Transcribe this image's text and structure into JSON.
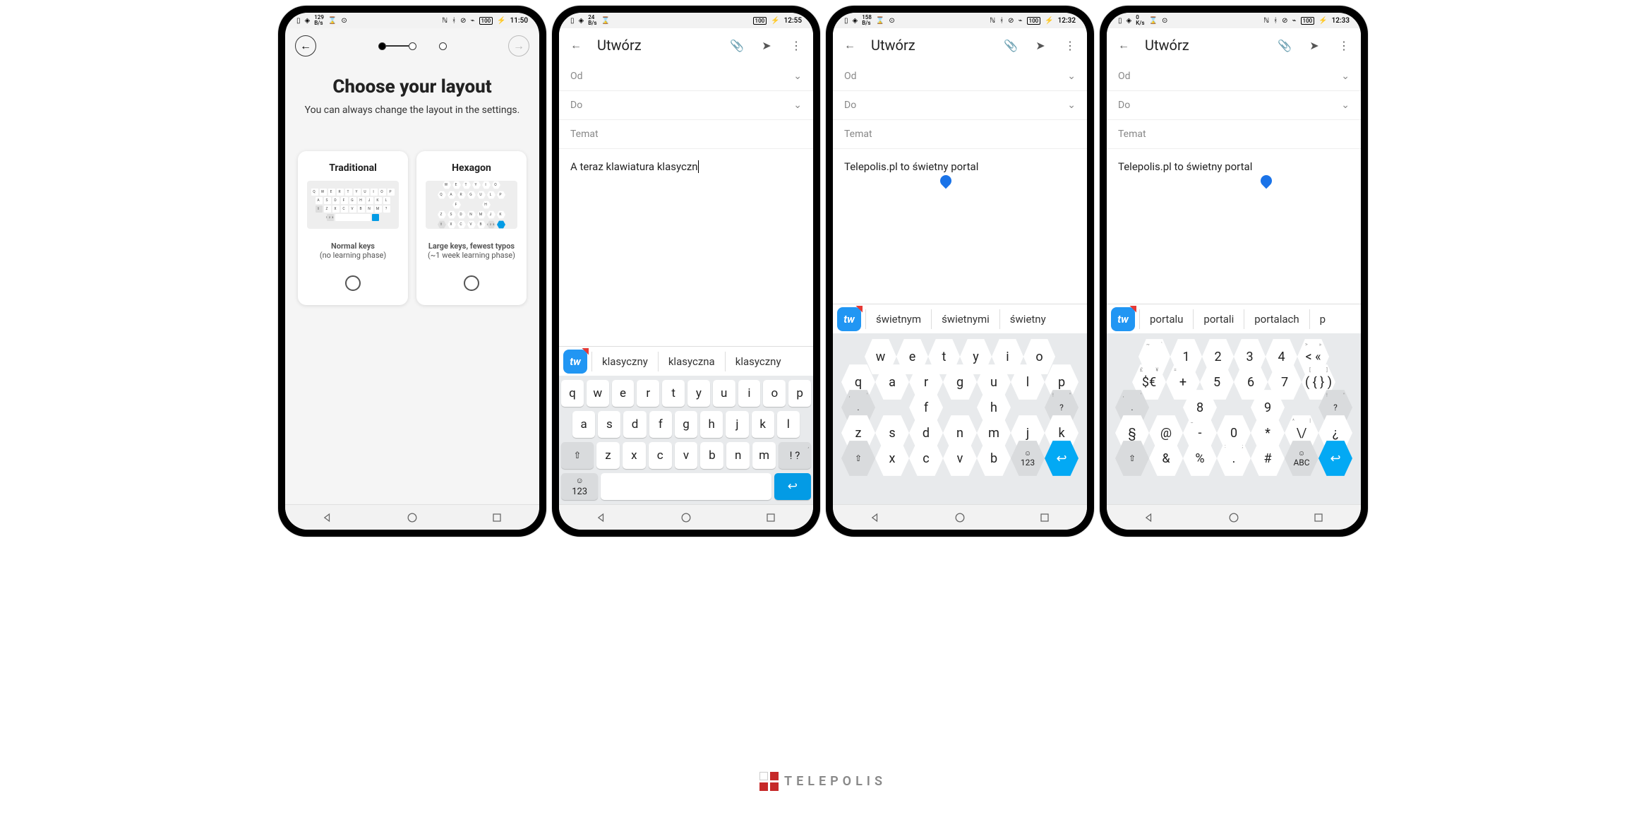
{
  "watermark": "TELEPOLIS",
  "screen1": {
    "status": {
      "time": "11:50",
      "battery": "100",
      "net_speed": "129",
      "net_unit": "B/s"
    },
    "title": "Choose your layout",
    "subtitle": "You can always change the layout in the settings.",
    "card_traditional": {
      "title": "Traditional",
      "desc_main": "Normal keys",
      "desc_sub": "(no learning phase)",
      "preview_rows": [
        [
          "Q",
          "W",
          "E",
          "R",
          "T",
          "Y",
          "U",
          "I",
          "O",
          "P"
        ],
        [
          "A",
          "S",
          "D",
          "F",
          "G",
          "H",
          "J",
          "K",
          "L"
        ],
        [
          "Z",
          "X",
          "C",
          "V",
          "B",
          "N",
          "M"
        ]
      ]
    },
    "card_hexagon": {
      "title": "Hexagon",
      "desc_main": "Large keys, fewest typos",
      "desc_sub": "(~1 week learning phase)",
      "preview_rows": [
        [
          "W",
          "E",
          "T",
          "Y",
          "I",
          "O"
        ],
        [
          "Q",
          "A",
          "R",
          "G",
          "U",
          "L",
          "P"
        ],
        [
          "F",
          "H"
        ],
        [
          "Z",
          "S",
          "D",
          "N",
          "M",
          "J",
          "K"
        ],
        [
          "X",
          "C",
          "V",
          "B"
        ]
      ]
    }
  },
  "screen2": {
    "status": {
      "time": "12:55",
      "battery": "100",
      "net_speed": "24",
      "net_unit": "B/s"
    },
    "compose_title": "Utwórz",
    "from_label": "Od",
    "to_label": "Do",
    "subject_label": "Temat",
    "body_text": "A teraz klawiatura klasyczn",
    "suggestions": [
      "klasyczny",
      "klasyczna",
      "klasyczny"
    ],
    "keyboard": {
      "row1": [
        "q",
        "w",
        "e",
        "r",
        "t",
        "y",
        "u",
        "i",
        "o",
        "p"
      ],
      "row2": [
        "a",
        "s",
        "d",
        "f",
        "g",
        "h",
        "j",
        "k",
        "l"
      ],
      "row3_mod_left": "⇧",
      "row3": [
        "z",
        "x",
        "c",
        "v",
        "b",
        "n",
        "m"
      ],
      "row3_punct": [
        ",",
        "!",
        "?"
      ],
      "row4_123": "123",
      "row4_emoji": "☺"
    }
  },
  "screen3": {
    "status": {
      "time": "12:32",
      "battery": "100",
      "net_speed": "158",
      "net_unit": "B/s"
    },
    "compose_title": "Utwórz",
    "from_label": "Od",
    "to_label": "Do",
    "subject_label": "Temat",
    "body_text": "Telepolis.pl to świetny portal",
    "suggestions": [
      "świetnym",
      "świetnymi",
      "świetny"
    ],
    "hex": {
      "r1": [
        "w",
        "e",
        "t",
        "y",
        "i",
        "o"
      ],
      "r2": [
        "q",
        "a",
        "r",
        "g",
        "u",
        "l",
        "p"
      ],
      "r3": [
        "f",
        "h"
      ],
      "r4": [
        "z",
        "s",
        "d",
        "n",
        "m",
        "j",
        "k"
      ],
      "r5_mod": "⇧",
      "r5": [
        "x",
        "c",
        "v",
        "b"
      ],
      "r5_emoji": "☺",
      "r5_123": "123",
      "r5_enter": "↩"
    }
  },
  "screen4": {
    "status": {
      "time": "12:33",
      "battery": "100",
      "net_speed": "0",
      "net_unit": "K/s"
    },
    "compose_title": "Utwórz",
    "from_label": "Od",
    "to_label": "Do",
    "subject_label": "Temat",
    "body_text": "Telepolis.pl to świetny portal",
    "suggestions": [
      "portalu",
      "portali",
      "portalach",
      "p"
    ],
    "hex": {
      "r1": [
        "~",
        "1",
        "2",
        "3",
        "4",
        ">"
      ],
      "r2": [
        "£",
        "$",
        "+",
        "5",
        "6",
        "7",
        "("
      ],
      "r3": [
        "8",
        "9"
      ],
      "r4": [
        "§",
        "@",
        "-",
        "0",
        "*",
        "\\",
        "¿"
      ],
      "r5_mod": "⇧",
      "r5": [
        "&",
        "%",
        ".",
        "#"
      ],
      "r5_emoji": "☺",
      "r5_abc": "ABC",
      "r5_enter": "↩"
    }
  }
}
